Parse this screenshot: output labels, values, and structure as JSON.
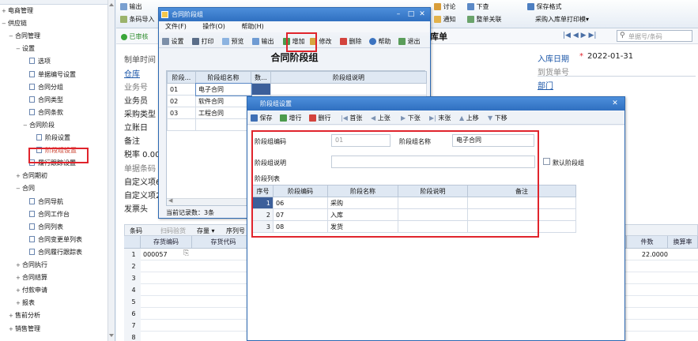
{
  "tree": {
    "items": [
      {
        "label": "电商管理",
        "level": 0,
        "twisty": "+"
      },
      {
        "label": "供应链",
        "level": 0,
        "twisty": "−"
      },
      {
        "label": "合同管理",
        "level": 1,
        "twisty": "−"
      },
      {
        "label": "设置",
        "level": 2,
        "twisty": "−"
      },
      {
        "label": "选项",
        "level": 3,
        "twisty": ""
      },
      {
        "label": "单据编号设置",
        "level": 3,
        "twisty": ""
      },
      {
        "label": "合同分组",
        "level": 3,
        "twisty": ""
      },
      {
        "label": "合同类型",
        "level": 3,
        "twisty": ""
      },
      {
        "label": "合同条款",
        "level": 3,
        "twisty": ""
      },
      {
        "label": "合同阶段",
        "level": 3,
        "twisty": "−"
      },
      {
        "label": "阶段设置",
        "level": 4,
        "twisty": ""
      },
      {
        "label": "阶段组设置",
        "level": 4,
        "twisty": ""
      },
      {
        "label": "履行跟踪设置",
        "level": 3,
        "twisty": ""
      },
      {
        "label": "合同期初",
        "level": 2,
        "twisty": "+"
      },
      {
        "label": "合同",
        "level": 2,
        "twisty": "−"
      },
      {
        "label": "合同导航",
        "level": 3,
        "twisty": ""
      },
      {
        "label": "合同工作台",
        "level": 3,
        "twisty": ""
      },
      {
        "label": "合同列表",
        "level": 3,
        "twisty": ""
      },
      {
        "label": "合同变更单列表",
        "level": 3,
        "twisty": ""
      },
      {
        "label": "合同履行跟踪表",
        "level": 3,
        "twisty": ""
      },
      {
        "label": "合同执行",
        "level": 2,
        "twisty": "+"
      },
      {
        "label": "合同结算",
        "level": 2,
        "twisty": "+"
      },
      {
        "label": "付款申请",
        "level": 2,
        "twisty": "+"
      },
      {
        "label": "报表",
        "level": 2,
        "twisty": "+"
      },
      {
        "label": "售前分析",
        "level": 1,
        "twisty": "+"
      },
      {
        "label": "销售管理",
        "level": 1,
        "twisty": "+"
      }
    ]
  },
  "topbar": {
    "export": "输出",
    "barcode_import": "条码导入",
    "discuss": "讨论",
    "notify": "通知",
    "push": "下查",
    "whole_link": "整单关联",
    "save_format": "保存格式",
    "print_template": "采购入库单打印模▾",
    "search_placeholder": "单据号/条码"
  },
  "status": "已审核",
  "doc_title": "库单",
  "form": {
    "entry_date_label": "入库日期",
    "entry_date_value": "2022-01-31",
    "arrival_no_label": "到货单号",
    "dept_label": "部门",
    "left_labels": [
      "制单时间",
      "仓库",
      "业务号",
      "业务员",
      "采购类型",
      "立账日",
      "备注",
      "税率 0.00",
      "单据条码",
      "自定义项6",
      "自定义项2",
      "发票头"
    ]
  },
  "grid": {
    "toolbar": [
      "条码",
      "扫码验货",
      "存量 ▾",
      "序列号 ▾"
    ],
    "headers": {
      "inv_code": "存货编码",
      "inv_alias": "存货代码",
      "qty": "件数",
      "conv": "换算率"
    },
    "rows": [
      {
        "no": "1",
        "code": "000057",
        "qty": "22.0000"
      },
      {
        "no": "2",
        "code": "",
        "qty": ""
      },
      {
        "no": "3",
        "code": "",
        "qty": ""
      },
      {
        "no": "4",
        "code": "",
        "qty": ""
      },
      {
        "no": "5",
        "code": "",
        "qty": ""
      },
      {
        "no": "6",
        "code": "",
        "qty": ""
      },
      {
        "no": "7",
        "code": "",
        "qty": ""
      },
      {
        "no": "8",
        "code": "",
        "qty": ""
      }
    ]
  },
  "win1": {
    "title": "合同阶段组",
    "menu": [
      "文件(F)",
      "操作(O)",
      "帮助(H)"
    ],
    "toolbar": [
      "设置",
      "打印",
      "预览",
      "输出",
      "增加",
      "修改",
      "删除",
      "帮助",
      "退出"
    ],
    "heading": "合同阶段组",
    "headers": [
      "阶段...",
      "阶段组名称",
      "数...",
      "阶段组说明"
    ],
    "rows": [
      {
        "code": "01",
        "name": "电子合同"
      },
      {
        "code": "02",
        "name": "软件合同"
      },
      {
        "code": "03",
        "name": "工程合同"
      }
    ],
    "footer": "当前记录数：3条"
  },
  "win2": {
    "title": "阶段组设置",
    "toolbar": [
      "保存",
      "增行",
      "删行",
      "首张",
      "上张",
      "下张",
      "末张",
      "上移",
      "下移"
    ],
    "code_label": "阶段组编码",
    "code_value": "01",
    "name_label": "阶段组名称",
    "name_value": "电子合同",
    "desc_label": "阶段组说明",
    "desc_value": "",
    "default_label": "默认阶段组",
    "list_label": "阶段列表",
    "headers": [
      "序号",
      "阶段编码",
      "阶段名称",
      "阶段说明",
      "备注"
    ],
    "rows": [
      {
        "no": "1",
        "code": "06",
        "name": "采购"
      },
      {
        "no": "2",
        "code": "07",
        "name": "入库"
      },
      {
        "no": "3",
        "code": "08",
        "name": "发货"
      }
    ]
  }
}
